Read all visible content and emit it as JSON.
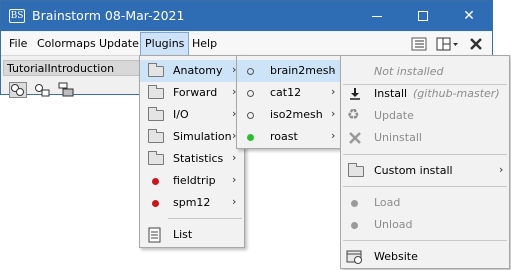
{
  "window": {
    "app_icon": "BS",
    "title": "Brainstorm 08-Mar-2021"
  },
  "menubar": {
    "items": [
      "File",
      "Colormaps",
      "Update",
      "Plugins",
      "Help"
    ],
    "active": "Plugins"
  },
  "toolbar": {
    "icons": [
      "layout-list-icon",
      "layout-grid-dropdown-icon",
      "close-tools-icon"
    ]
  },
  "protocol": {
    "tab_label": "TutorialIntroduction",
    "icons": [
      "subjects-view-icon",
      "data-view-icon",
      "study-view-icon"
    ]
  },
  "plugins_menu": {
    "items": [
      {
        "label": "Anatomy",
        "icon": "folder-icon",
        "submenu": true,
        "highlighted": true
      },
      {
        "label": "Forward",
        "icon": "folder-icon",
        "submenu": true
      },
      {
        "label": "I/O",
        "icon": "folder-icon",
        "submenu": true
      },
      {
        "label": "Simulation",
        "icon": "folder-icon",
        "submenu": true
      },
      {
        "label": "Statistics",
        "icon": "folder-icon",
        "submenu": true
      },
      {
        "label": "fieldtrip",
        "icon": "red-dot-icon",
        "submenu": true
      },
      {
        "label": "spm12",
        "icon": "red-dot-icon",
        "submenu": true
      },
      {
        "label": "List",
        "icon": "document-icon",
        "submenu": false
      }
    ]
  },
  "anatomy_menu": {
    "items": [
      {
        "label": "brain2mesh",
        "icon": "hollow-dot-icon",
        "highlighted": true
      },
      {
        "label": "cat12",
        "icon": "hollow-dot-icon"
      },
      {
        "label": "iso2mesh",
        "icon": "hollow-dot-icon"
      },
      {
        "label": "roast",
        "icon": "green-dot-icon"
      }
    ]
  },
  "plugin_actions_menu": {
    "status": "Not installed",
    "install_label": "Install",
    "install_note": "(github-master)",
    "update_label": "Update",
    "uninstall_label": "Uninstall",
    "custom_install_label": "Custom install",
    "load_label": "Load",
    "unload_label": "Unload",
    "website_label": "Website"
  },
  "colors": {
    "titlebar": "#2e6db4",
    "highlight": "#cde3f7",
    "installed": "#2ebd2e",
    "error": "#c8161d"
  }
}
